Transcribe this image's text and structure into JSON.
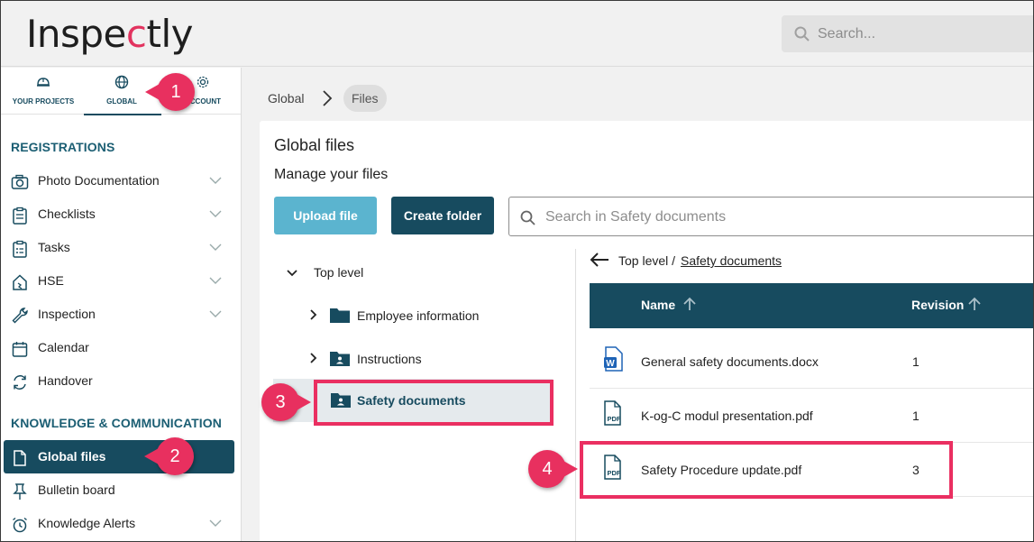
{
  "header": {
    "logo_text_1": "Inspe",
    "logo_accent": "c",
    "logo_text_2": "tly",
    "search_placeholder": "Search..."
  },
  "nav_tabs": [
    {
      "label": "YOUR PROJECTS",
      "icon": "helmet-icon"
    },
    {
      "label": "GLOBAL",
      "icon": "globe-icon"
    },
    {
      "label": "ACCOUNT",
      "icon": "gear-icon"
    }
  ],
  "sidebar": {
    "section_registrations": "REGISTRATIONS",
    "section_knowledge": "KNOWLEDGE & COMMUNICATION",
    "items": [
      {
        "label": "Photo Documentation",
        "icon": "camera-icon",
        "expandable": true
      },
      {
        "label": "Checklists",
        "icon": "clipboard-icon",
        "expandable": true
      },
      {
        "label": "Tasks",
        "icon": "task-list-icon",
        "expandable": true
      },
      {
        "label": "HSE",
        "icon": "hse-icon",
        "expandable": true
      },
      {
        "label": "Inspection",
        "icon": "wrench-icon",
        "expandable": true
      },
      {
        "label": "Calendar",
        "icon": "calendar-icon",
        "expandable": false
      },
      {
        "label": "Handover",
        "icon": "handover-icon",
        "expandable": false
      },
      {
        "label": "Global files",
        "icon": "file-icon",
        "active": true
      },
      {
        "label": "Bulletin board",
        "icon": "pin-icon",
        "expandable": false
      },
      {
        "label": "Knowledge Alerts",
        "icon": "alarm-icon",
        "expandable": true
      }
    ]
  },
  "breadcrumb": {
    "root": "Global",
    "current": "Files"
  },
  "main": {
    "title": "Global files",
    "subtitle": "Manage your files",
    "upload_label": "Upload file",
    "create_folder_label": "Create folder",
    "search_placeholder": "Search in Safety documents"
  },
  "tree": {
    "root": "Top level",
    "folders": [
      "Employee information",
      "Instructions",
      "Safety documents"
    ],
    "selected": "Safety documents"
  },
  "file_path": {
    "root": "Top level /",
    "folder": "Safety documents"
  },
  "table": {
    "columns": [
      "Name",
      "Revision"
    ],
    "rows": [
      {
        "name": "General safety documents.docx",
        "revision": "1",
        "type": "word"
      },
      {
        "name": "K-og-C modul presentation.pdf",
        "revision": "1",
        "type": "pdf"
      },
      {
        "name": "Safety Procedure update.pdf",
        "revision": "3",
        "type": "pdf"
      }
    ]
  },
  "annotations": [
    "1",
    "2",
    "3",
    "4"
  ],
  "colors": {
    "primary": "#174b5f",
    "accent": "#5bb4cf",
    "annotation": "#e8305f"
  }
}
